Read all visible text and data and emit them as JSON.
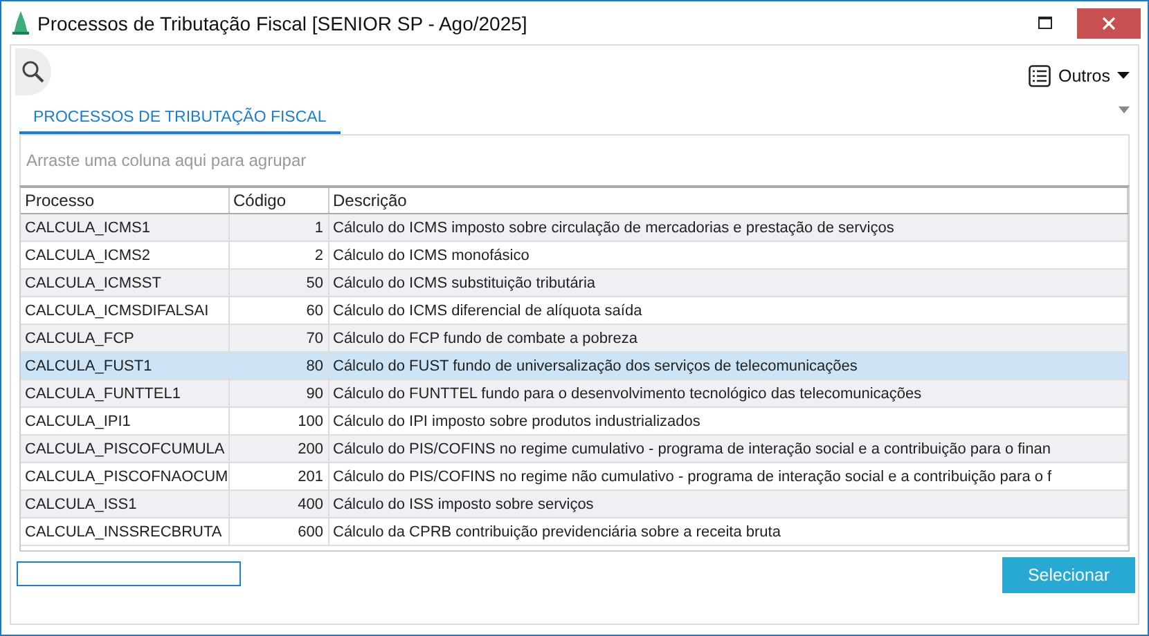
{
  "window": {
    "title": "Processos de Tributação Fiscal [SENIOR SP - Ago/2025]"
  },
  "toolbar": {
    "menu": {
      "label": "Outros"
    }
  },
  "tabs": [
    {
      "label": "PROCESSOS DE TRIBUTAÇÃO FISCAL",
      "selected": true
    }
  ],
  "group_panel": {
    "placeholder": "Arraste uma coluna aqui para agrupar"
  },
  "table": {
    "columns": [
      "Processo",
      "Código",
      "Descrição"
    ],
    "rows": [
      {
        "cells": [
          "CALCULA_ICMS1",
          "1",
          "Cálculo do ICMS imposto sobre circulação de mercadorias e prestação de serviços"
        ],
        "selected": false
      },
      {
        "cells": [
          "CALCULA_ICMS2",
          "2",
          "Cálculo do ICMS monofásico"
        ],
        "selected": false
      },
      {
        "cells": [
          "CALCULA_ICMSST",
          "50",
          "Cálculo do ICMS substituição tributária"
        ],
        "selected": false
      },
      {
        "cells": [
          "CALCULA_ICMSDIFALSAI",
          "60",
          "Cálculo do ICMS diferencial de alíquota saída"
        ],
        "selected": false
      },
      {
        "cells": [
          "CALCULA_FCP",
          "70",
          "Cálculo do FCP fundo de combate a pobreza"
        ],
        "selected": false
      },
      {
        "cells": [
          "CALCULA_FUST1",
          "80",
          "Cálculo do FUST fundo de universalização dos serviços de telecomunicações"
        ],
        "selected": true
      },
      {
        "cells": [
          "CALCULA_FUNTTEL1",
          "90",
          "Cálculo do FUNTTEL fundo para o desenvolvimento tecnológico das telecomunicações"
        ],
        "selected": false
      },
      {
        "cells": [
          "CALCULA_IPI1",
          "100",
          "Cálculo do IPI imposto sobre produtos industrializados"
        ],
        "selected": false
      },
      {
        "cells": [
          "CALCULA_PISCOFCUMULA",
          "200",
          "Cálculo do PIS/COFINS no regime cumulativo - programa de interação social e a contribuição para o finan"
        ],
        "selected": false
      },
      {
        "cells": [
          "CALCULA_PISCOFNAOCUM",
          "201",
          "Cálculo do PIS/COFINS no regime não cumulativo - programa de interação social e a contribuição para o f"
        ],
        "selected": false
      },
      {
        "cells": [
          "CALCULA_ISS1",
          "400",
          "Cálculo do ISS imposto sobre serviços"
        ],
        "selected": false
      },
      {
        "cells": [
          "CALCULA_INSSRECBRUTA",
          "600",
          "Cálculo da CPRB contribuição previdenciária sobre a receita bruta"
        ],
        "selected": false
      }
    ]
  },
  "footer": {
    "button": {
      "label": "Selecionar"
    }
  }
}
